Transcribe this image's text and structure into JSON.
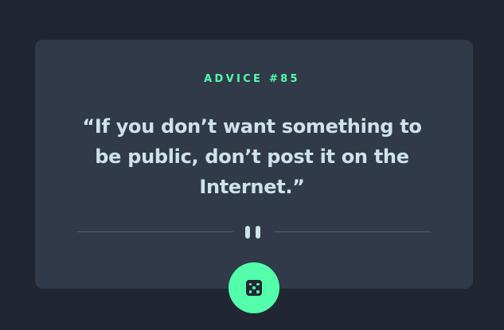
{
  "advice": {
    "label": "ADVICE #85",
    "quote_lines": [
      "“If you don’t want something to",
      "be public, don’t post it on the",
      "Internet.”"
    ]
  },
  "divider": {
    "icon": "pause-icon"
  },
  "generate_button": {
    "icon": "dice-icon"
  },
  "colors": {
    "background": "#202733",
    "card": "#313a48",
    "accent": "#53ffaa",
    "text": "#cee3e9",
    "divider": "#4f5d74"
  }
}
